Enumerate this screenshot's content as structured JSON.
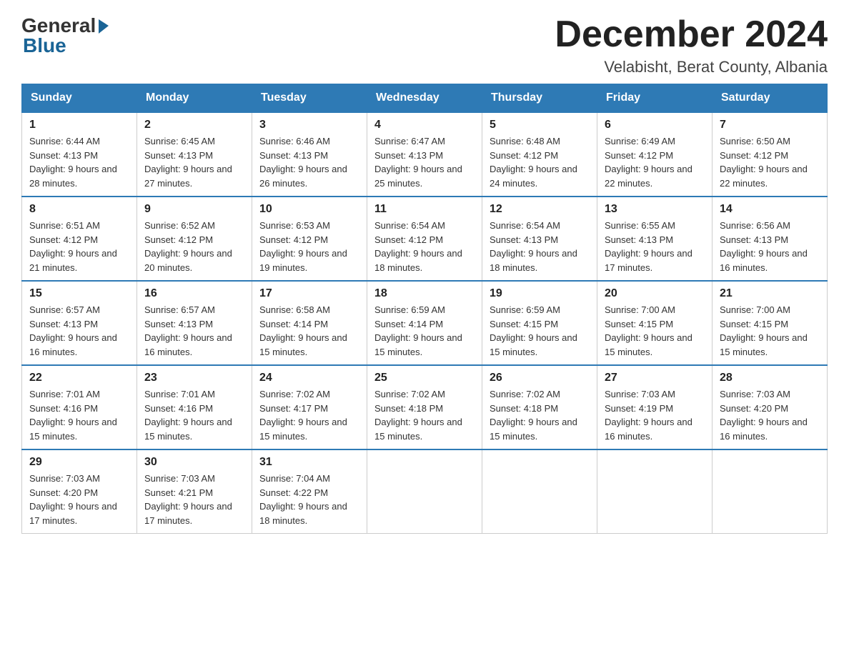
{
  "header": {
    "logo": {
      "general": "General",
      "blue": "Blue",
      "arrow": "▶"
    },
    "title": "December 2024",
    "location": "Velabisht, Berat County, Albania"
  },
  "days_of_week": [
    "Sunday",
    "Monday",
    "Tuesday",
    "Wednesday",
    "Thursday",
    "Friday",
    "Saturday"
  ],
  "weeks": [
    [
      {
        "day": "1",
        "sunrise": "Sunrise: 6:44 AM",
        "sunset": "Sunset: 4:13 PM",
        "daylight": "Daylight: 9 hours and 28 minutes."
      },
      {
        "day": "2",
        "sunrise": "Sunrise: 6:45 AM",
        "sunset": "Sunset: 4:13 PM",
        "daylight": "Daylight: 9 hours and 27 minutes."
      },
      {
        "day": "3",
        "sunrise": "Sunrise: 6:46 AM",
        "sunset": "Sunset: 4:13 PM",
        "daylight": "Daylight: 9 hours and 26 minutes."
      },
      {
        "day": "4",
        "sunrise": "Sunrise: 6:47 AM",
        "sunset": "Sunset: 4:13 PM",
        "daylight": "Daylight: 9 hours and 25 minutes."
      },
      {
        "day": "5",
        "sunrise": "Sunrise: 6:48 AM",
        "sunset": "Sunset: 4:12 PM",
        "daylight": "Daylight: 9 hours and 24 minutes."
      },
      {
        "day": "6",
        "sunrise": "Sunrise: 6:49 AM",
        "sunset": "Sunset: 4:12 PM",
        "daylight": "Daylight: 9 hours and 22 minutes."
      },
      {
        "day": "7",
        "sunrise": "Sunrise: 6:50 AM",
        "sunset": "Sunset: 4:12 PM",
        "daylight": "Daylight: 9 hours and 22 minutes."
      }
    ],
    [
      {
        "day": "8",
        "sunrise": "Sunrise: 6:51 AM",
        "sunset": "Sunset: 4:12 PM",
        "daylight": "Daylight: 9 hours and 21 minutes."
      },
      {
        "day": "9",
        "sunrise": "Sunrise: 6:52 AM",
        "sunset": "Sunset: 4:12 PM",
        "daylight": "Daylight: 9 hours and 20 minutes."
      },
      {
        "day": "10",
        "sunrise": "Sunrise: 6:53 AM",
        "sunset": "Sunset: 4:12 PM",
        "daylight": "Daylight: 9 hours and 19 minutes."
      },
      {
        "day": "11",
        "sunrise": "Sunrise: 6:54 AM",
        "sunset": "Sunset: 4:12 PM",
        "daylight": "Daylight: 9 hours and 18 minutes."
      },
      {
        "day": "12",
        "sunrise": "Sunrise: 6:54 AM",
        "sunset": "Sunset: 4:13 PM",
        "daylight": "Daylight: 9 hours and 18 minutes."
      },
      {
        "day": "13",
        "sunrise": "Sunrise: 6:55 AM",
        "sunset": "Sunset: 4:13 PM",
        "daylight": "Daylight: 9 hours and 17 minutes."
      },
      {
        "day": "14",
        "sunrise": "Sunrise: 6:56 AM",
        "sunset": "Sunset: 4:13 PM",
        "daylight": "Daylight: 9 hours and 16 minutes."
      }
    ],
    [
      {
        "day": "15",
        "sunrise": "Sunrise: 6:57 AM",
        "sunset": "Sunset: 4:13 PM",
        "daylight": "Daylight: 9 hours and 16 minutes."
      },
      {
        "day": "16",
        "sunrise": "Sunrise: 6:57 AM",
        "sunset": "Sunset: 4:13 PM",
        "daylight": "Daylight: 9 hours and 16 minutes."
      },
      {
        "day": "17",
        "sunrise": "Sunrise: 6:58 AM",
        "sunset": "Sunset: 4:14 PM",
        "daylight": "Daylight: 9 hours and 15 minutes."
      },
      {
        "day": "18",
        "sunrise": "Sunrise: 6:59 AM",
        "sunset": "Sunset: 4:14 PM",
        "daylight": "Daylight: 9 hours and 15 minutes."
      },
      {
        "day": "19",
        "sunrise": "Sunrise: 6:59 AM",
        "sunset": "Sunset: 4:15 PM",
        "daylight": "Daylight: 9 hours and 15 minutes."
      },
      {
        "day": "20",
        "sunrise": "Sunrise: 7:00 AM",
        "sunset": "Sunset: 4:15 PM",
        "daylight": "Daylight: 9 hours and 15 minutes."
      },
      {
        "day": "21",
        "sunrise": "Sunrise: 7:00 AM",
        "sunset": "Sunset: 4:15 PM",
        "daylight": "Daylight: 9 hours and 15 minutes."
      }
    ],
    [
      {
        "day": "22",
        "sunrise": "Sunrise: 7:01 AM",
        "sunset": "Sunset: 4:16 PM",
        "daylight": "Daylight: 9 hours and 15 minutes."
      },
      {
        "day": "23",
        "sunrise": "Sunrise: 7:01 AM",
        "sunset": "Sunset: 4:16 PM",
        "daylight": "Daylight: 9 hours and 15 minutes."
      },
      {
        "day": "24",
        "sunrise": "Sunrise: 7:02 AM",
        "sunset": "Sunset: 4:17 PM",
        "daylight": "Daylight: 9 hours and 15 minutes."
      },
      {
        "day": "25",
        "sunrise": "Sunrise: 7:02 AM",
        "sunset": "Sunset: 4:18 PM",
        "daylight": "Daylight: 9 hours and 15 minutes."
      },
      {
        "day": "26",
        "sunrise": "Sunrise: 7:02 AM",
        "sunset": "Sunset: 4:18 PM",
        "daylight": "Daylight: 9 hours and 15 minutes."
      },
      {
        "day": "27",
        "sunrise": "Sunrise: 7:03 AM",
        "sunset": "Sunset: 4:19 PM",
        "daylight": "Daylight: 9 hours and 16 minutes."
      },
      {
        "day": "28",
        "sunrise": "Sunrise: 7:03 AM",
        "sunset": "Sunset: 4:20 PM",
        "daylight": "Daylight: 9 hours and 16 minutes."
      }
    ],
    [
      {
        "day": "29",
        "sunrise": "Sunrise: 7:03 AM",
        "sunset": "Sunset: 4:20 PM",
        "daylight": "Daylight: 9 hours and 17 minutes."
      },
      {
        "day": "30",
        "sunrise": "Sunrise: 7:03 AM",
        "sunset": "Sunset: 4:21 PM",
        "daylight": "Daylight: 9 hours and 17 minutes."
      },
      {
        "day": "31",
        "sunrise": "Sunrise: 7:04 AM",
        "sunset": "Sunset: 4:22 PM",
        "daylight": "Daylight: 9 hours and 18 minutes."
      },
      null,
      null,
      null,
      null
    ]
  ]
}
